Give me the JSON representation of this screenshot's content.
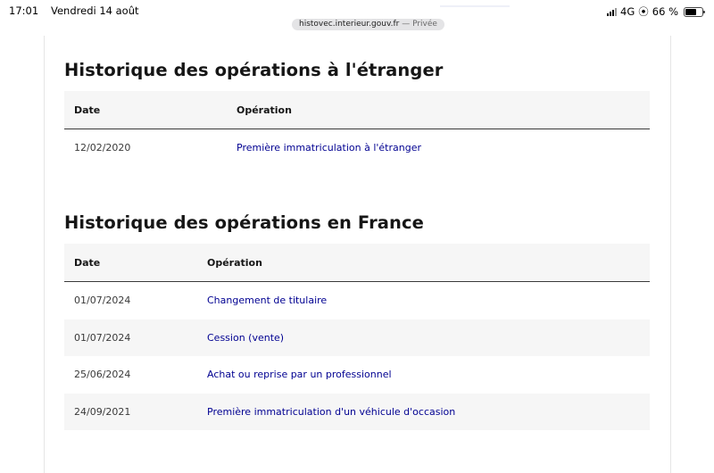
{
  "status_bar": {
    "time": "17:01",
    "date": "Vendredi 14 août",
    "network": "4G",
    "battery": "66 %",
    "battery_level": 0.66
  },
  "url_bar": {
    "domain": "histovec.interieur.gouv.fr",
    "mode": "— Privée"
  },
  "sections": {
    "abroad": {
      "title": "Historique des opérations à l'étranger",
      "headers": {
        "date": "Date",
        "operation": "Opération"
      },
      "rows": [
        {
          "date": "12/02/2020",
          "operation": "Première immatriculation à l'étranger"
        }
      ]
    },
    "france": {
      "title": "Historique des opérations en France",
      "headers": {
        "date": "Date",
        "operation": "Opération"
      },
      "rows": [
        {
          "date": "01/07/2024",
          "operation": "Changement de titulaire"
        },
        {
          "date": "01/07/2024",
          "operation": "Cession (vente)"
        },
        {
          "date": "25/06/2024",
          "operation": "Achat ou reprise par un professionnel"
        },
        {
          "date": "24/09/2021",
          "operation": "Première immatriculation d'un véhicule d'occasion"
        }
      ]
    }
  },
  "colors": {
    "link": "#000091",
    "header_bg": "#f6f6f6",
    "text": "#161616"
  }
}
